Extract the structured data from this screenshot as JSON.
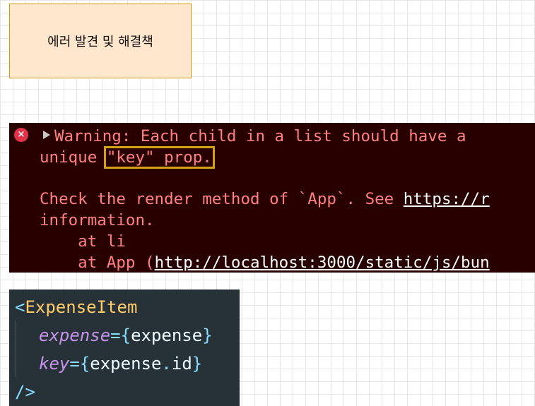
{
  "note": {
    "text": "에러 발견 및 해결책"
  },
  "console": {
    "error_icon": "×",
    "line1": "Warning: Each child in a list should have a",
    "line2_prefix": "unique ",
    "line2_highlight": "\"key\" prop.",
    "line3_text": "Check the render method of `App`. See ",
    "line3_link": "https://r",
    "line4": "information.",
    "line5": "    at li",
    "line6_prefix": "    at App (",
    "line6_link": "http://localhost:3000/static/js/bun"
  },
  "code": {
    "open_bracket": "<",
    "tag_name": "ExpenseItem",
    "attr1_name": "expense",
    "attr1_value": "expense",
    "attr2_name": "key",
    "attr2_object": "expense",
    "attr2_prop": "id",
    "close": "/>"
  }
}
